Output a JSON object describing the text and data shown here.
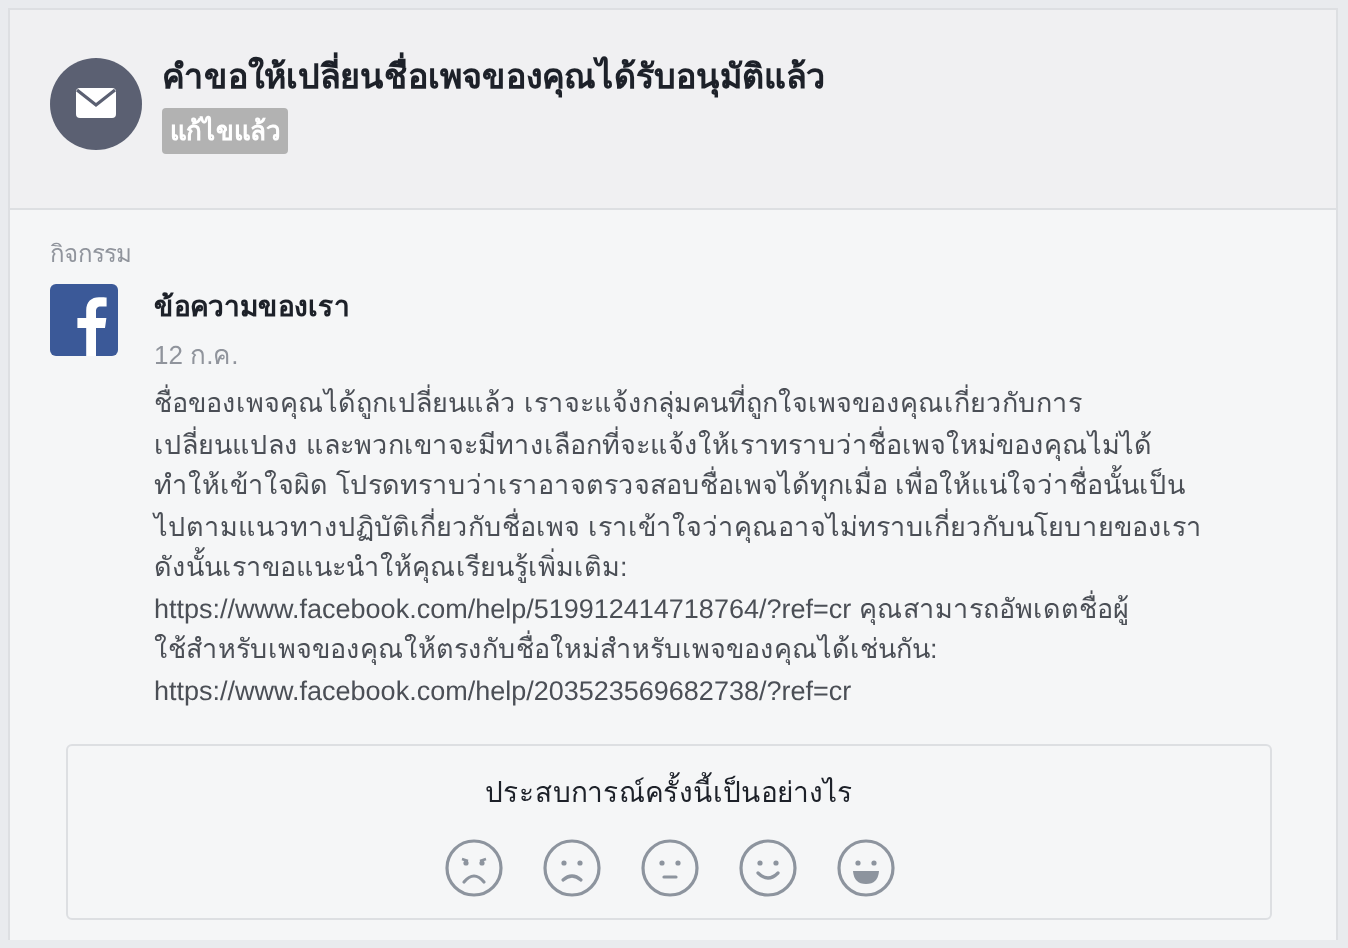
{
  "header": {
    "title": "คำขอให้เปลี่ยนชื่อเพจของคุณได้รับอนุมัติแล้ว",
    "tag": "แก้ไขแล้ว"
  },
  "activity": {
    "label": "กิจกรรม",
    "sender": "ข้อความของเรา",
    "date": "12 ก.ค.",
    "message_lines": [
      "ชื่อของเพจคุณได้ถูกเปลี่ยนแล้ว เราจะแจ้งกลุ่มคนที่ถูกใจเพจของคุณเกี่ยวกับการ",
      "เปลี่ยนแปลง และพวกเขาจะมีทางเลือกที่จะแจ้งให้เราทราบว่าชื่อเพจใหม่ของคุณไม่ได้",
      "ทำให้เข้าใจผิด โปรดทราบว่าเราอาจตรวจสอบชื่อเพจได้ทุกเมื่อ เพื่อให้แน่ใจว่าชื่อนั้นเป็น",
      "ไปตามแนวทางปฏิบัติเกี่ยวกับชื่อเพจ เราเข้าใจว่าคุณอาจไม่ทราบเกี่ยวกับนโยบายของเรา",
      "ดังนั้นเราขอแนะนำให้คุณเรียนรู้เพิ่มเติม:",
      "https://www.facebook.com/help/519912414718764/?ref=cr คุณสามารถอัพเดตชื่อผู้",
      "ใช้สำหรับเพจของคุณให้ตรงกับชื่อใหม่สำหรับเพจของคุณได้เช่นกัน:",
      "https://www.facebook.com/help/203523569682738/?ref=cr"
    ]
  },
  "feedback": {
    "question": "ประสบการณ์ครั้งนี้เป็นอย่างไร",
    "faces": [
      {
        "kind": "very_sad"
      },
      {
        "kind": "sad"
      },
      {
        "kind": "neutral"
      },
      {
        "kind": "smile"
      },
      {
        "kind": "grin"
      }
    ]
  }
}
